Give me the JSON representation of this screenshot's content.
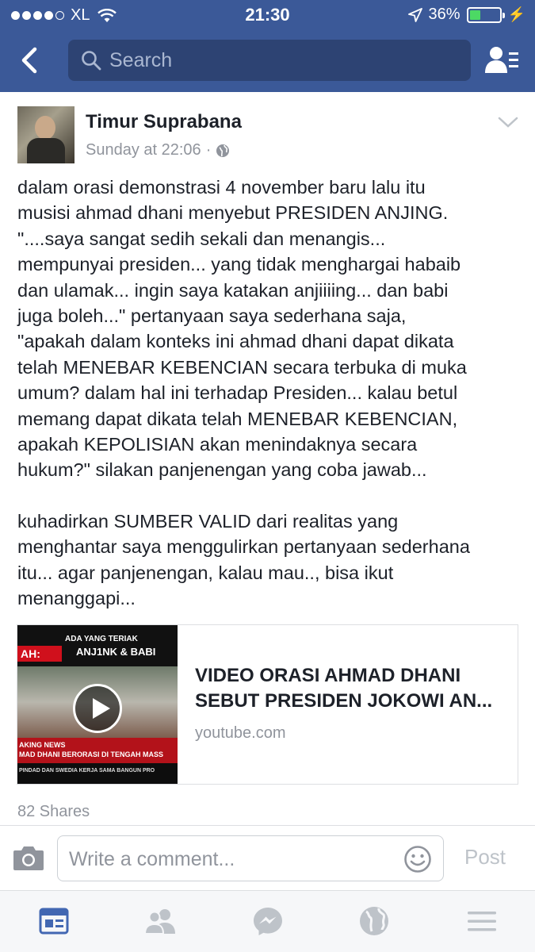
{
  "status_bar": {
    "carrier": "XL",
    "time": "21:30",
    "battery": "36%",
    "battery_level": 0.36
  },
  "nav": {
    "search_placeholder": "Search"
  },
  "post": {
    "author": "Timur Suprabana",
    "timestamp": "Sunday at 22:06",
    "separator": "·",
    "paragraphs": [
      "dalam orasi demonstrasi 4 november baru lalu itu\nmusisi ahmad dhani menyebut PRESIDEN ANJING.\n\"....saya sangat sedih sekali dan menangis...\nmempunyai presiden... yang tidak menghargai habaib\ndan ulamak... ingin saya katakan anjiiiing... dan babi\njuga boleh...\" pertanyaan saya sederhana saja,\n\"apakah dalam konteks ini ahmad dhani dapat dikata\ntelah MENEBAR KEBENCIAN secara terbuka di muka\numum? dalam hal ini terhadap Presiden... kalau betul\nmemang dapat dikata telah MENEBAR KEBENCIAN,\napakah KEPOLISIAN akan menindaknya secara\nhukum?\" silakan panjenengan yang coba jawab...",
      "kuhadirkan SUMBER VALID dari realitas yang\nmenghantar saya menggulirkan pertanyaan sederhana\nitu... agar panjenengan, kalau mau.., bisa ikut\nmenanggapi..."
    ],
    "link": {
      "title": "VIDEO ORASI AHMAD DHANI\nSEBUT PRESIDEN JOKOWI AN...",
      "domain": "youtube.com",
      "thumbnail_text": {
        "headline_small": "ADA YANG TERIAK",
        "headline_big": "ANJ1NK & BABI",
        "tag": "AH:",
        "breaking": "AKING NEWS",
        "ticker": "MAD DHANI BERORASI DI TENGAH MASS",
        "ticker2": "PINDAD DAN SWEDIA KERJA SAMA BANGUN PRO"
      }
    },
    "shares": "82 Shares"
  },
  "comment_bar": {
    "placeholder": "Write a comment...",
    "post_label": "Post"
  },
  "tabbar": {
    "tabs": [
      "news-feed",
      "friends",
      "messenger",
      "notifications",
      "more"
    ],
    "active": "news-feed"
  },
  "colors": {
    "brand_blue": "#3b5998",
    "search_bg": "#2d4373",
    "active_tab": "#4267b2",
    "inactive_tab": "#bec3c9",
    "battery_green": "#4cd964"
  }
}
